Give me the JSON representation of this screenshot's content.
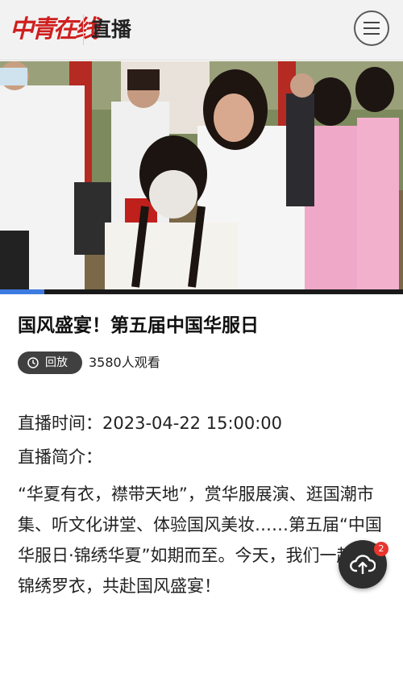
{
  "header": {
    "logo_text": "中青在线",
    "title": "直播",
    "menu_icon": "hamburger-menu-icon"
  },
  "video": {
    "progress_percent": 11,
    "progress_color": "#3d7be0"
  },
  "article": {
    "title": "国风盛宴！第五届中国华服日",
    "replay_label": "回放",
    "replay_icon": "clock-icon",
    "views": "3580人观看",
    "time_label": "直播时间：",
    "time_value": "2023-04-22 15:00:00",
    "intro_label": "直播简介：",
    "intro_text": "“华夏有衣，襟带天地”，赏华服展演、逛国潮市集、听文化讲堂、体验国风美妆……第五届“中国华服日·锦绣华夏”如期而至。今天，我们一起着锦绣罗衣，共赴国风盛宴！"
  },
  "fab": {
    "icon": "cloud-upload-icon",
    "badge_count": "2"
  },
  "colors": {
    "brand_red": "#cf1f1f",
    "badge_red": "#e8352e",
    "dark_button": "#2e2e2e"
  }
}
